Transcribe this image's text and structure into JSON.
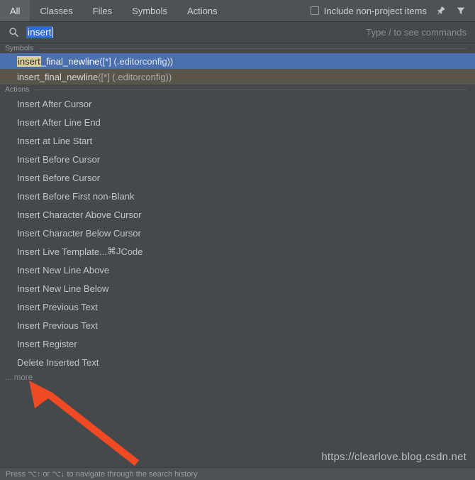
{
  "tabs": [
    {
      "label": "All",
      "active": true
    },
    {
      "label": "Classes",
      "active": false
    },
    {
      "label": "Files",
      "active": false
    },
    {
      "label": "Symbols",
      "active": false
    },
    {
      "label": "Actions",
      "active": false
    }
  ],
  "toolbar": {
    "include_non_project_label": "Include non-project items",
    "include_non_project_checked": false,
    "pin_icon": "pin-icon",
    "filter_icon": "filter-icon"
  },
  "search": {
    "icon": "search-icon",
    "value": "insert",
    "selected": true,
    "hint": "Type / to see commands"
  },
  "groups": [
    {
      "title": "Symbols",
      "items": [
        {
          "match": "insert",
          "rest": "_final_newline",
          "detail": " ([*] (.editorconfig))",
          "state": "selected"
        },
        {
          "match": "",
          "rest": "insert_final_newline",
          "detail": " ([*] (.editorconfig))",
          "state": "hovered"
        }
      ]
    },
    {
      "title": "Actions",
      "items": [
        {
          "label": "Insert After Cursor",
          "shortcut": "",
          "right": ""
        },
        {
          "label": "Insert After Line End",
          "shortcut": "",
          "right": ""
        },
        {
          "label": "Insert at Line Start",
          "shortcut": "",
          "right": ""
        },
        {
          "label": "Insert Before Cursor",
          "shortcut": "",
          "right": ""
        },
        {
          "label": "Insert Before Cursor",
          "shortcut": "",
          "right": ""
        },
        {
          "label": "Insert Before First non-Blank",
          "shortcut": "",
          "right": ""
        },
        {
          "label": "Insert Character Above Cursor",
          "shortcut": "",
          "right": ""
        },
        {
          "label": "Insert Character Below Cursor",
          "shortcut": "",
          "right": ""
        },
        {
          "label": "Insert Live Template...",
          "shortcut": "⌘J",
          "right": "Code"
        },
        {
          "label": "Insert New Line Above",
          "shortcut": "",
          "right": ""
        },
        {
          "label": "Insert New Line Below",
          "shortcut": "",
          "right": ""
        },
        {
          "label": "Insert Previous Text",
          "shortcut": "",
          "right": ""
        },
        {
          "label": "Insert Previous Text",
          "shortcut": "",
          "right": ""
        },
        {
          "label": "Insert Register",
          "shortcut": "",
          "right": ""
        },
        {
          "label": "Delete Inserted Text",
          "shortcut": "",
          "right": ""
        }
      ]
    }
  ],
  "more_label": "... more",
  "annotation": {
    "arrow_color": "#f04a24",
    "name": "red-arrow-annotation"
  },
  "watermark": "https://clearlove.blog.csdn.net",
  "statusbar": {
    "hint": "Press ⌥↑ or ⌥↓ to navigate through the search history"
  },
  "colors": {
    "background": "#45494c",
    "tabbar": "#4e5254",
    "selected_row": "#4b6eaf",
    "hovered_row": "#5a5449",
    "match_highlight": "#d8cf9a",
    "text_selection": "#2f6ccc",
    "accent_arrow": "#f04a24"
  }
}
